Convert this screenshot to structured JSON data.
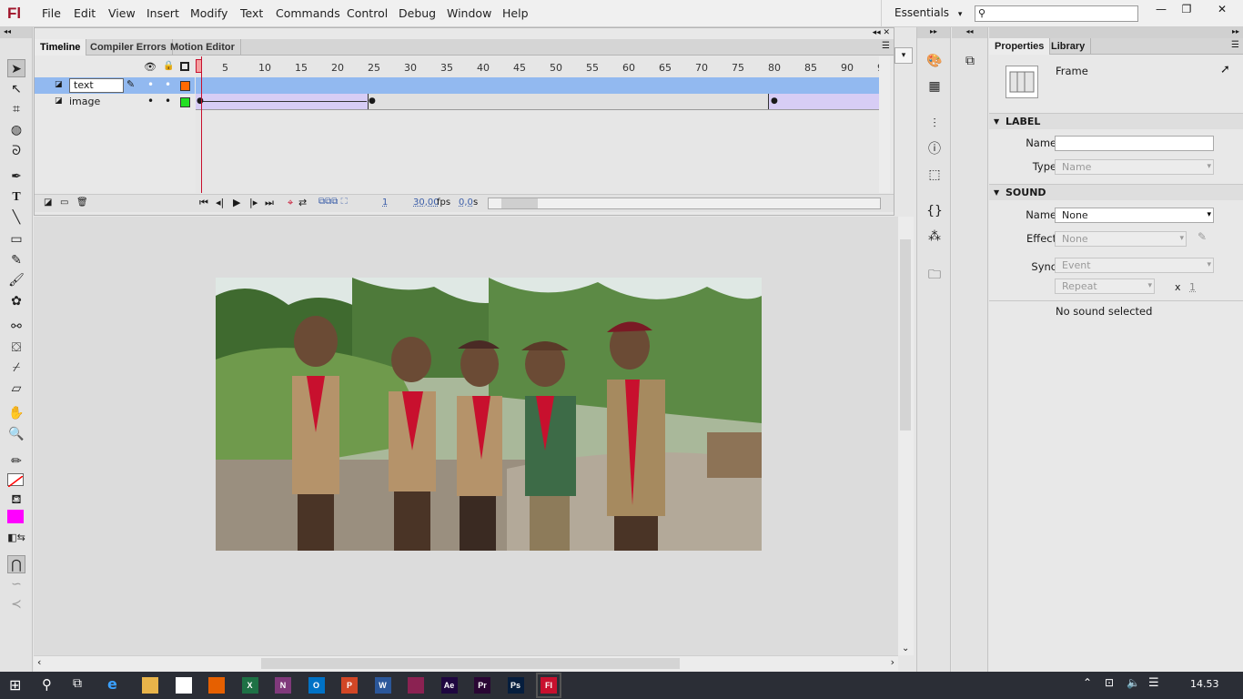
{
  "app": {
    "logo": "Fl"
  },
  "menu": [
    "File",
    "Edit",
    "View",
    "Insert",
    "Modify",
    "Text",
    "Commands",
    "Control",
    "Debug",
    "Window",
    "Help"
  ],
  "workspace": {
    "label": "Essentials",
    "arrow": "▾"
  },
  "window_buttons": {
    "minimize": "—",
    "restore": "❐",
    "close": "✕"
  },
  "timeline": {
    "tabs": [
      "Timeline",
      "Compiler Errors",
      "Motion Editor"
    ],
    "ruler": [
      "1",
      "5",
      "10",
      "15",
      "20",
      "25",
      "30",
      "35",
      "40",
      "45",
      "50",
      "55",
      "60",
      "65",
      "70",
      "75",
      "80",
      "85",
      "90",
      "9"
    ],
    "layers": [
      {
        "name": "text",
        "editing": true
      },
      {
        "name": "image",
        "editing": false
      }
    ],
    "current_frame": "1",
    "fps": "30,00",
    "fps_unit": "fps",
    "time": "0,0",
    "time_unit": "s"
  },
  "properties": {
    "tabs": [
      "Properties",
      "Library"
    ],
    "type_label": "Frame",
    "label_section": "LABEL",
    "name_label": "Name:",
    "name_value": "",
    "type_field_label": "Type:",
    "type_value": "Name",
    "sound_section": "SOUND",
    "sound_name_label": "Name:",
    "sound_name_value": "None",
    "effect_label": "Effect:",
    "effect_value": "None",
    "sync_label": "Sync:",
    "sync_value": "Event",
    "repeat_value": "Repeat",
    "repeat_x": "x",
    "repeat_count": "1",
    "no_sound": "No sound selected"
  },
  "taskbar": {
    "apps": [
      {
        "name": "File Explorer",
        "abbr": "",
        "color": "#e8b44a"
      },
      {
        "name": "Store",
        "abbr": "",
        "color": "#ffffff"
      },
      {
        "name": "Firefox",
        "abbr": "",
        "color": "#e66000"
      },
      {
        "name": "Excel",
        "abbr": "X",
        "color": "#1e7145"
      },
      {
        "name": "OneNote",
        "abbr": "N",
        "color": "#80397b"
      },
      {
        "name": "Outlook",
        "abbr": "O",
        "color": "#0072c6"
      },
      {
        "name": "PowerPoint",
        "abbr": "P",
        "color": "#d24726"
      },
      {
        "name": "Word",
        "abbr": "W",
        "color": "#2b579a"
      },
      {
        "name": "WinRAR",
        "abbr": "",
        "color": "#8b2252"
      },
      {
        "name": "After Effects",
        "abbr": "Ae",
        "color": "#1f0740"
      },
      {
        "name": "Premiere",
        "abbr": "Pr",
        "color": "#2a0634"
      },
      {
        "name": "Photoshop",
        "abbr": "Ps",
        "color": "#061e3e"
      },
      {
        "name": "Flash",
        "abbr": "Fl",
        "color": "#c8102e"
      }
    ],
    "clock": "14.53"
  },
  "colors": {
    "accent": "#c8102e",
    "layer_selected": "#92b9f0",
    "text_layer_color": "#ff6a00",
    "image_layer_color": "#22e022",
    "fill_color": "#ff00ff"
  }
}
